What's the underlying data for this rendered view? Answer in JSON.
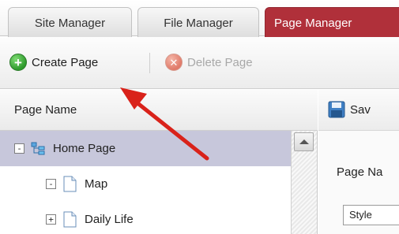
{
  "tabs": [
    {
      "label": "Site Manager",
      "active": false
    },
    {
      "label": "File Manager",
      "active": false
    },
    {
      "label": "Page Manager",
      "active": true
    }
  ],
  "toolbar": {
    "create_label": "Create Page",
    "create_icon": "add-circle-icon",
    "delete_label": "Delete Page",
    "delete_icon": "delete-circle-icon",
    "delete_enabled": false
  },
  "tree": {
    "header": "Page Name",
    "items": [
      {
        "label": "Home Page",
        "expander": "-",
        "icon": "sitemap-icon",
        "selected": true
      },
      {
        "label": "Map",
        "expander": "-",
        "icon": "page-icon",
        "selected": false
      },
      {
        "label": "Daily Life",
        "expander": "+",
        "icon": "page-icon",
        "selected": false
      }
    ]
  },
  "editor": {
    "save_label": "Sav",
    "save_icon": "floppy-disk-icon",
    "field_label": "Page Na",
    "style_value": "Style"
  },
  "colors": {
    "active_tab": "#b0303a",
    "selected_row": "#c7c7db",
    "annotation_arrow": "#d9221a"
  }
}
